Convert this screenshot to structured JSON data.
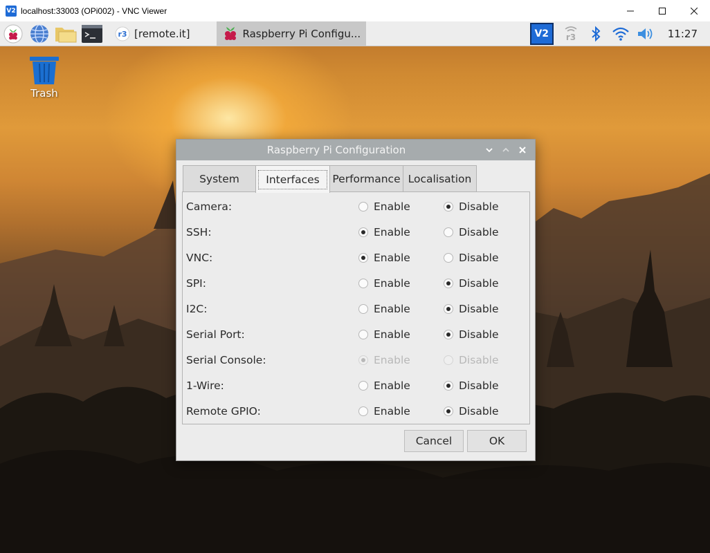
{
  "window": {
    "app_icon_text": "V2",
    "title": "localhost:33003 (OPi002) - VNC Viewer"
  },
  "panel": {
    "launchers": [
      "raspberry-menu-icon",
      "web-browser-icon",
      "file-manager-icon",
      "terminal-icon"
    ],
    "tasks": [
      {
        "label": "[remote.it]",
        "icon": "remoteit-icon",
        "active": false
      },
      {
        "label": "Raspberry Pi Configu...",
        "icon": "raspberry-icon",
        "active": true
      }
    ],
    "tray": {
      "vnc_icon_text": "V2",
      "clock": "11:27"
    }
  },
  "desktop": {
    "icons": [
      {
        "label": "Trash",
        "icon": "trash-icon"
      }
    ]
  },
  "dialog": {
    "title": "Raspberry Pi Configuration",
    "tabs": [
      {
        "label": "System",
        "active": false
      },
      {
        "label": "Interfaces",
        "active": true
      },
      {
        "label": "Performance",
        "active": false
      },
      {
        "label": "Localisation",
        "active": false
      }
    ],
    "enable_label": "Enable",
    "disable_label": "Disable",
    "interfaces": [
      {
        "label": "Camera:",
        "value": "disable",
        "enabled": true
      },
      {
        "label": "SSH:",
        "value": "enable",
        "enabled": true
      },
      {
        "label": "VNC:",
        "value": "enable",
        "enabled": true
      },
      {
        "label": "SPI:",
        "value": "disable",
        "enabled": true
      },
      {
        "label": "I2C:",
        "value": "disable",
        "enabled": true
      },
      {
        "label": "Serial Port:",
        "value": "disable",
        "enabled": true
      },
      {
        "label": "Serial Console:",
        "value": "enable",
        "enabled": false
      },
      {
        "label": "1-Wire:",
        "value": "disable",
        "enabled": true
      },
      {
        "label": "Remote GPIO:",
        "value": "disable",
        "enabled": true
      }
    ],
    "cancel_label": "Cancel",
    "ok_label": "OK"
  },
  "colors": {
    "panel_bg": "#ededed",
    "dialog_titlebar": "#a6abad",
    "dialog_bg": "#ececec",
    "vnc_blue": "#1e6bd6",
    "trash_blue": "#1b6fd1",
    "raspberry_red": "#c51a4a"
  }
}
